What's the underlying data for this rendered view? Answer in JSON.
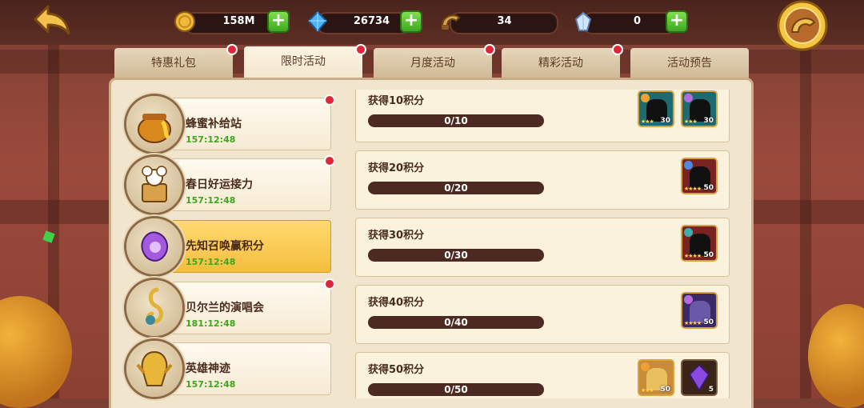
{
  "resources": [
    {
      "icon": "gold-coin-icon",
      "value": "158M"
    },
    {
      "icon": "diamond-icon",
      "value": "26734"
    },
    {
      "icon": "horn-token-icon",
      "value": "34"
    },
    {
      "icon": "crystal-icon",
      "value": "0"
    }
  ],
  "tabs": [
    "特惠礼包",
    "限时活动",
    "月度活动",
    "精彩活动",
    "活动预告"
  ],
  "active_tab": "限时活动",
  "events": [
    {
      "name": "蜂蜜补给站",
      "time": "157:12:48",
      "icon": "honey-pot-icon"
    },
    {
      "name": "春日好运接力",
      "time": "157:12:48",
      "icon": "lucky-cat-icon"
    },
    {
      "name": "先知召唤赢积分",
      "time": "157:12:48",
      "icon": "prophet-orb-icon"
    },
    {
      "name": "贝尔兰的演唱会",
      "time": "181:12:48",
      "icon": "treble-clef-icon"
    },
    {
      "name": "英雄神迹",
      "time": "157:12:48",
      "icon": "golden-hero-icon"
    }
  ],
  "rewards": [
    {
      "label": "获得10积分",
      "progress": "0/10",
      "level_a": "30",
      "level_b": "30"
    },
    {
      "label": "获得20积分",
      "progress": "0/20",
      "level_a": "50"
    },
    {
      "label": "获得30积分",
      "progress": "0/30",
      "level_a": "50"
    },
    {
      "label": "获得40积分",
      "progress": "0/40",
      "level_a": "50"
    },
    {
      "label": "获得50积分",
      "progress": "0/50",
      "level_a": "50",
      "level_b": "5"
    }
  ],
  "colors": {
    "accent_red": "#e0243a",
    "timer_green": "#3fa51e",
    "plus_green": "#4cc02a"
  }
}
